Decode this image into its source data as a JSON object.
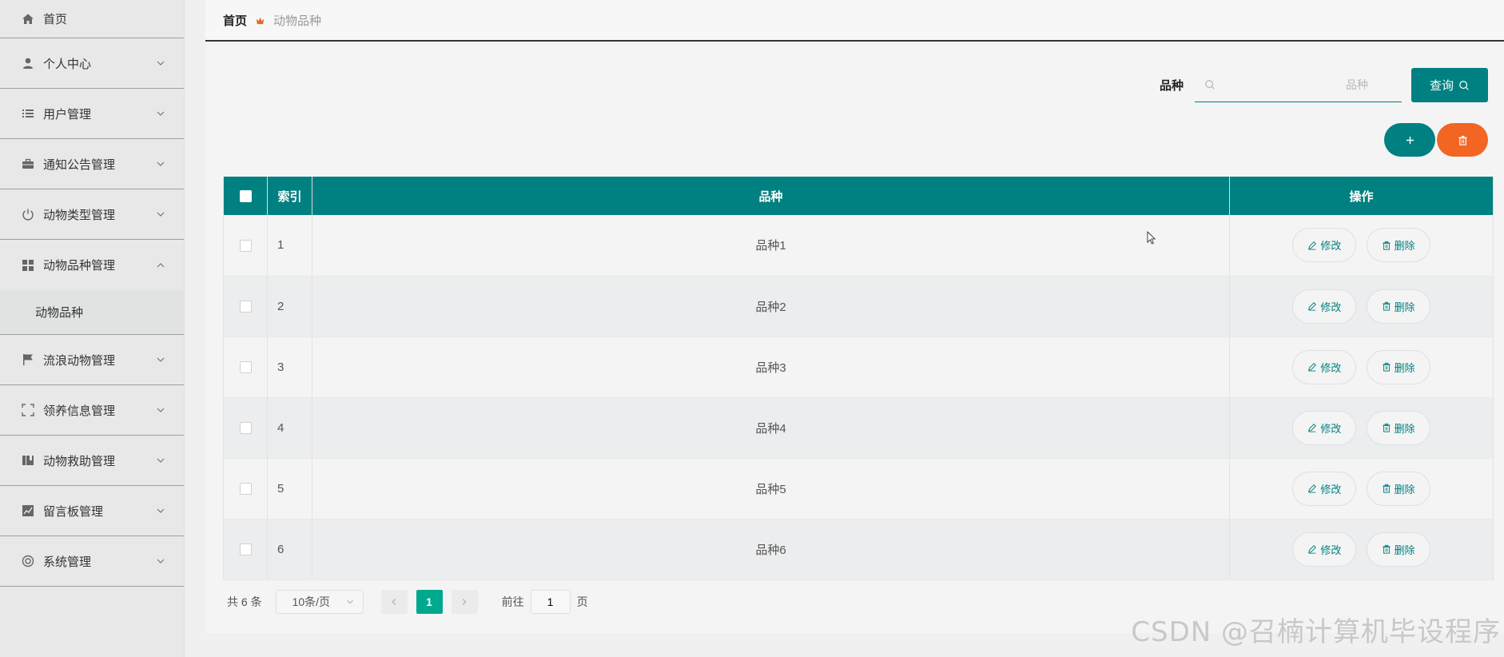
{
  "sidebar": {
    "items": [
      {
        "label": "首页",
        "icon": "home-icon"
      },
      {
        "label": "个人中心",
        "icon": "user-icon"
      },
      {
        "label": "用户管理",
        "icon": "list-icon"
      },
      {
        "label": "通知公告管理",
        "icon": "briefcase-icon"
      },
      {
        "label": "动物类型管理",
        "icon": "power-icon"
      },
      {
        "label": "动物品种管理",
        "icon": "grid-icon"
      },
      {
        "label": "流浪动物管理",
        "icon": "flag-icon"
      },
      {
        "label": "领养信息管理",
        "icon": "fullscreen-icon"
      },
      {
        "label": "动物救助管理",
        "icon": "book-icon"
      },
      {
        "label": "留言板管理",
        "icon": "chart-icon"
      },
      {
        "label": "系统管理",
        "icon": "lifebuoy-icon"
      }
    ],
    "submenu": {
      "label": "动物品种"
    }
  },
  "breadcrumb": {
    "home": "首页",
    "current": "动物品种"
  },
  "search": {
    "label": "品种",
    "placeholder": "品种",
    "button": "查询"
  },
  "table": {
    "headers": {
      "index": "索引",
      "name": "品种",
      "ops": "操作"
    },
    "rows": [
      {
        "index": "1",
        "name": "品种1"
      },
      {
        "index": "2",
        "name": "品种2"
      },
      {
        "index": "3",
        "name": "品种3"
      },
      {
        "index": "4",
        "name": "品种4"
      },
      {
        "index": "5",
        "name": "品种5"
      },
      {
        "index": "6",
        "name": "品种6"
      }
    ],
    "edit_label": "修改",
    "delete_label": "删除"
  },
  "pagination": {
    "total": "共 6 条",
    "page_size": "10条/页",
    "current_page": "1",
    "goto_prefix": "前往",
    "goto_value": "1",
    "goto_suffix": "页"
  },
  "watermark": "CSDN @召楠计算机毕设程序",
  "colors": {
    "accent": "#008080",
    "danger": "#f26522",
    "page_active": "#00a88e"
  }
}
